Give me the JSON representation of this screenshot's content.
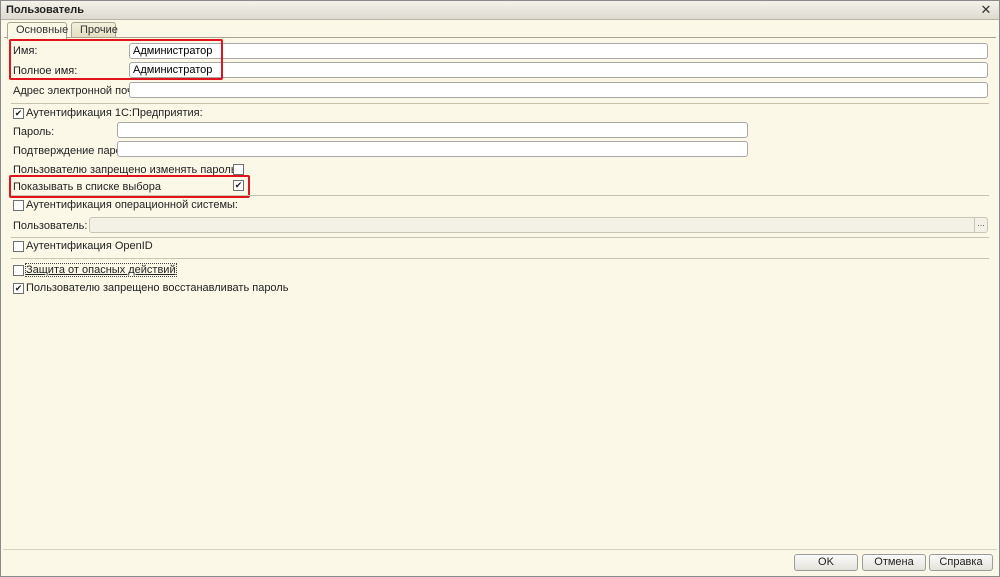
{
  "window": {
    "title": "Пользователь",
    "close_icon": "close-icon"
  },
  "tabs": [
    {
      "label": "Основные",
      "active": true
    },
    {
      "label": "Прочие",
      "active": false
    }
  ],
  "form": {
    "name_label": "Имя:",
    "name_value": "Администратор",
    "fullname_label": "Полное имя:",
    "fullname_value": "Администратор",
    "email_label": "Адрес электронной почты:",
    "email_value": "",
    "auth_1c_label": "Аутентификация 1С:Предприятия:",
    "auth_1c_checked": true,
    "password_label": "Пароль:",
    "password_value": "",
    "password_confirm_label": "Подтверждение пароля:",
    "password_confirm_value": "",
    "cannot_change_password_label": "Пользователю запрещено изменять пароль",
    "cannot_change_password_checked": false,
    "show_in_list_label": "Показывать в списке выбора",
    "show_in_list_checked": true,
    "auth_os_label": "Аутентификация операционной системы:",
    "auth_os_checked": false,
    "os_user_label": "Пользователь:",
    "os_user_value": "",
    "os_user_picker": "...",
    "auth_openid_label": "Аутентификация OpenID",
    "auth_openid_checked": false,
    "dangerous_actions_label": "Защита от опасных действий",
    "dangerous_actions_checked": false,
    "cannot_restore_password_label": "Пользователю запрещено восстанавливать пароль",
    "cannot_restore_password_checked": true
  },
  "buttons": {
    "ok": "OK",
    "cancel": "Отмена",
    "help": "Справка"
  },
  "colors": {
    "highlight": "#e0141b",
    "background": "#fbf8e8"
  }
}
